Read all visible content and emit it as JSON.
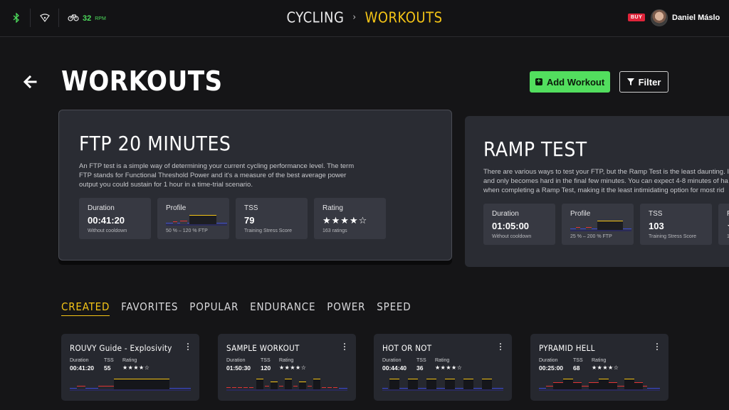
{
  "topbar": {
    "rpm_value": "32",
    "rpm_unit": "RPM",
    "breadcrumb": [
      "CYCLING",
      "WORKOUTS"
    ],
    "breadcrumb_separator": "›",
    "buy_label": "BUY",
    "user_name": "Daniel Máslo",
    "icons": [
      "bluetooth-icon",
      "wifi-sensor-icon",
      "bike-icon"
    ]
  },
  "header": {
    "title": "WORKOUTS",
    "add_label": "Add Workout",
    "filter_label": "Filter"
  },
  "featured": [
    {
      "title": "FTP 20 MINUTES",
      "description": "An FTP test is a simple way of determining your current cycling performance level. The term FTP stands for Functional Threshold Power and it's a measure of the best average power output you could sustain for 1 hour in a time-trial scenario.",
      "duration_label": "Duration",
      "duration": "00:41:20",
      "duration_sub": "Without cooldown",
      "profile_label": "Profile",
      "profile_sub": "50 % – 120 % FTP",
      "tss_label": "TSS",
      "tss": "79",
      "tss_sub": "Training Stress Score",
      "rating_label": "Rating",
      "rating": 4,
      "rating_stars": "★★★★☆",
      "rating_sub": "163 ratings"
    },
    {
      "title": "RAMP TEST",
      "description": "There are various ways to test your FTP, but the Ramp Test is the least daunting. It and only becomes hard in the final few minutes. You can expect 4-8 minutes of ha when completing a Ramp Test, making it the least intimidating option for most rid",
      "duration_label": "Duration",
      "duration": "01:05:00",
      "duration_sub": "Without cooldown",
      "profile_label": "Profile",
      "profile_sub": "25 % – 200 % FTP",
      "tss_label": "TSS",
      "tss": "103",
      "tss_sub": "Training Stress Score",
      "rating_label": "R",
      "rating_stars": "★",
      "rating_sub": "1"
    }
  ],
  "tabs": [
    "CREATED",
    "FAVORITES",
    "POPULAR",
    "ENDURANCE",
    "POWER",
    "SPEED"
  ],
  "active_tab": "CREATED",
  "workouts": [
    {
      "title": "ROUVY Guide - Explosivity",
      "duration": "00:41:20",
      "tss": "55",
      "rating": 4,
      "stars": "★★★★☆"
    },
    {
      "title": "SAMPLE WORKOUT",
      "duration": "01:50:30",
      "tss": "120",
      "rating": 4,
      "stars": "★★★★☆"
    },
    {
      "title": "HOT OR NOT",
      "duration": "00:44:40",
      "tss": "36",
      "rating": 4,
      "stars": "★★★★☆"
    },
    {
      "title": "PYRAMID HELL",
      "duration": "00:25:00",
      "tss": "68",
      "rating": 4,
      "stars": "★★★★☆"
    }
  ],
  "workout_labels": {
    "duration": "Duration",
    "tss": "TSS",
    "rating": "Rating"
  },
  "colors": {
    "accent_yellow": "#f4c416",
    "accent_green": "#52de5e",
    "buy_red": "#e0243a",
    "zone_blue": "#3b4bd8",
    "zone_red": "#e03535",
    "zone_yellow": "#f4c416"
  }
}
